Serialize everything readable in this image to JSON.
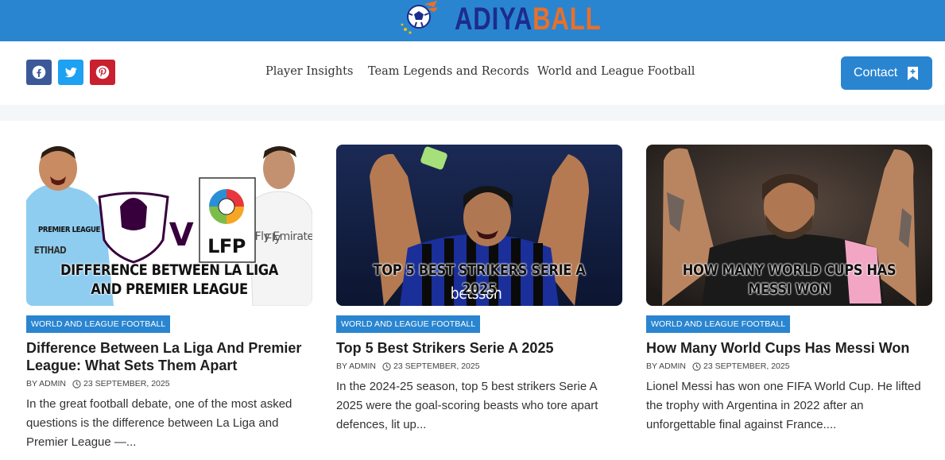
{
  "brand": {
    "name_part1": "ADIYA",
    "name_part2": "BALL",
    "logo_icon": "soccer-ball-icon",
    "colors": {
      "bar": "#2a85d0",
      "part1": "#1d2c8c",
      "part2": "#e8702a"
    }
  },
  "social": [
    {
      "name": "facebook",
      "icon": "facebook-icon",
      "color": "#3b5998"
    },
    {
      "name": "twitter",
      "icon": "twitter-icon",
      "color": "#1da1f2"
    },
    {
      "name": "pinterest",
      "icon": "pinterest-icon",
      "color": "#c8202f"
    }
  ],
  "nav": {
    "items": [
      {
        "label": "Player Insights"
      },
      {
        "label": "Team Legends and Records"
      },
      {
        "label": "World and League Football"
      }
    ]
  },
  "contact": {
    "label": "Contact",
    "icon": "bookmark-icon"
  },
  "posts": [
    {
      "category": "World and League Football",
      "title": "Difference Between La Liga And Premier League: What Sets Them Apart",
      "author": "BY ADMIN",
      "date": "23 SEPTEMBER, 2025",
      "excerpt": "In the great football debate, one of the most asked questions is the difference between La Liga and Premier League —...",
      "image_text": "DIFFERENCE BETWEEN LA LIGA AND PREMIER LEAGUE",
      "image_logo_left": "PREMIER LEAGUE",
      "image_vs": "V",
      "image_logo_right": "LFP",
      "image_shirt_text": "Fly Emirates",
      "image_shirt_text_left": "ETIHAD"
    },
    {
      "category": "World and League Football",
      "title": "Top 5 Best Strikers Serie A 2025",
      "author": "BY ADMIN",
      "date": "23 SEPTEMBER, 2025",
      "excerpt": "In the 2024-25 season, top 5 best strikers Serie A 2025 were the goal-scoring beasts who tore apart defences, lit up...",
      "image_text": "TOP 5 BEST STRIKERS SERIE A 2025",
      "image_shirt_text": "betsson"
    },
    {
      "category": "World and League Football",
      "title": "How Many World Cups Has Messi Won",
      "author": "BY ADMIN",
      "date": "23 SEPTEMBER, 2025",
      "excerpt": "Lionel Messi has won one FIFA World Cup. He lifted the trophy with Argentina in 2022 after an unforgettable final against France....",
      "image_text": "HOW MANY WORLD CUPS HAS MESSI WON"
    }
  ]
}
